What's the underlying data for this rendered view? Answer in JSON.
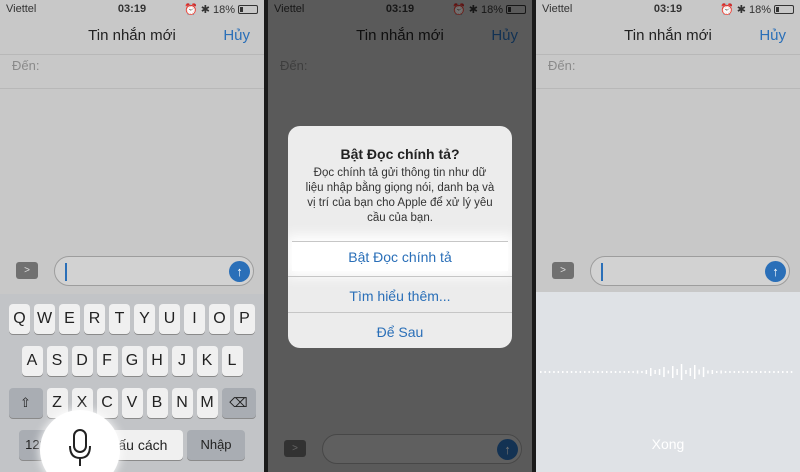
{
  "status": {
    "carrier": "Viettel",
    "time": "03:19",
    "battery": "18%"
  },
  "nav": {
    "title": "Tin nhắn mới",
    "cancel": "Hủy"
  },
  "to_label": "Đến:",
  "keyboard": {
    "row1": [
      "Q",
      "W",
      "E",
      "R",
      "T",
      "Y",
      "U",
      "I",
      "O",
      "P"
    ],
    "row2": [
      "A",
      "S",
      "D",
      "F",
      "G",
      "H",
      "J",
      "K",
      "L"
    ],
    "row3": [
      "Z",
      "X",
      "C",
      "V",
      "B",
      "N",
      "M"
    ],
    "numbers_key": "123",
    "space_key": "dấu cách",
    "return_key": "Nhập"
  },
  "alert": {
    "title": "Bật Đọc chính tả?",
    "message": "Đọc chính tả gửi thông tin như dữ liệu nhập bằng giọng nói, danh bạ và vị trí của bạn cho Apple để xử lý yêu cầu của bạn.",
    "enable_button": "Bật Đọc chính tả",
    "learn_more_button": "Tìm hiểu thêm...",
    "later_button": "Để Sau"
  },
  "dictation": {
    "done_label": "Xong"
  },
  "icons": {
    "wifi": "wifi-icon",
    "location": "location-icon",
    "alarm": "alarm-icon",
    "bluetooth": "bluetooth-icon",
    "battery": "battery-icon",
    "camera": "camera-icon",
    "send": "send-arrow-icon",
    "shift": "shift-icon",
    "delete": "delete-icon",
    "mic": "microphone-icon"
  },
  "colors": {
    "accent": "#2a6fb8"
  }
}
